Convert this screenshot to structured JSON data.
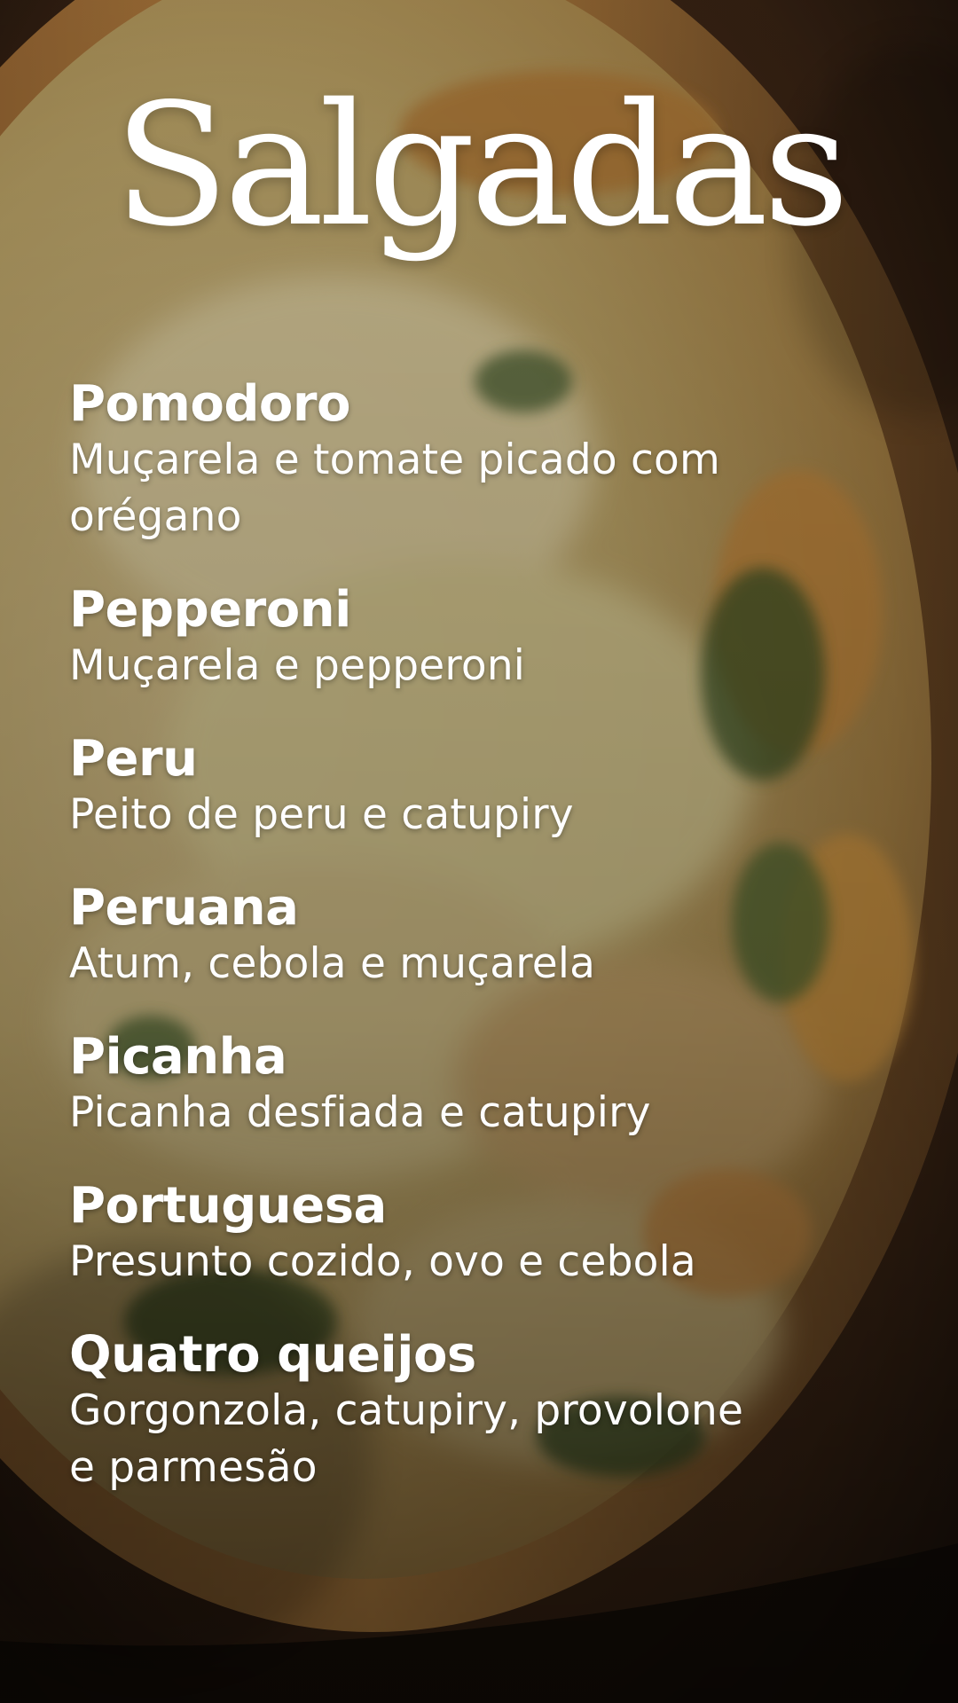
{
  "page": {
    "title": "Salgadas"
  },
  "menu": {
    "items": [
      {
        "name": "Pomodoro",
        "description": "Muçarela e tomate picado com orégano"
      },
      {
        "name": "Pepperoni",
        "description": "Muçarela e pepperoni"
      },
      {
        "name": "Peru",
        "description": "Peito de peru e catupiry"
      },
      {
        "name": "Peruana",
        "description": "Atum, cebola e muçarela"
      },
      {
        "name": "Picanha",
        "description": "Picanha desfiada e catupiry"
      },
      {
        "name": "Portuguesa",
        "description": "Presunto cozido, ovo e cebola"
      },
      {
        "name": "Quatro queijos",
        "description": "Gorgonzola, catupiry, provolone e parmesão"
      }
    ]
  },
  "background": {
    "image": "pizza-photo",
    "colors": {
      "board": "#3a2414",
      "crust": "#b57a35",
      "cheese": "#c9b27a",
      "herbs": "#3d5427",
      "dark": "#120c07"
    }
  }
}
